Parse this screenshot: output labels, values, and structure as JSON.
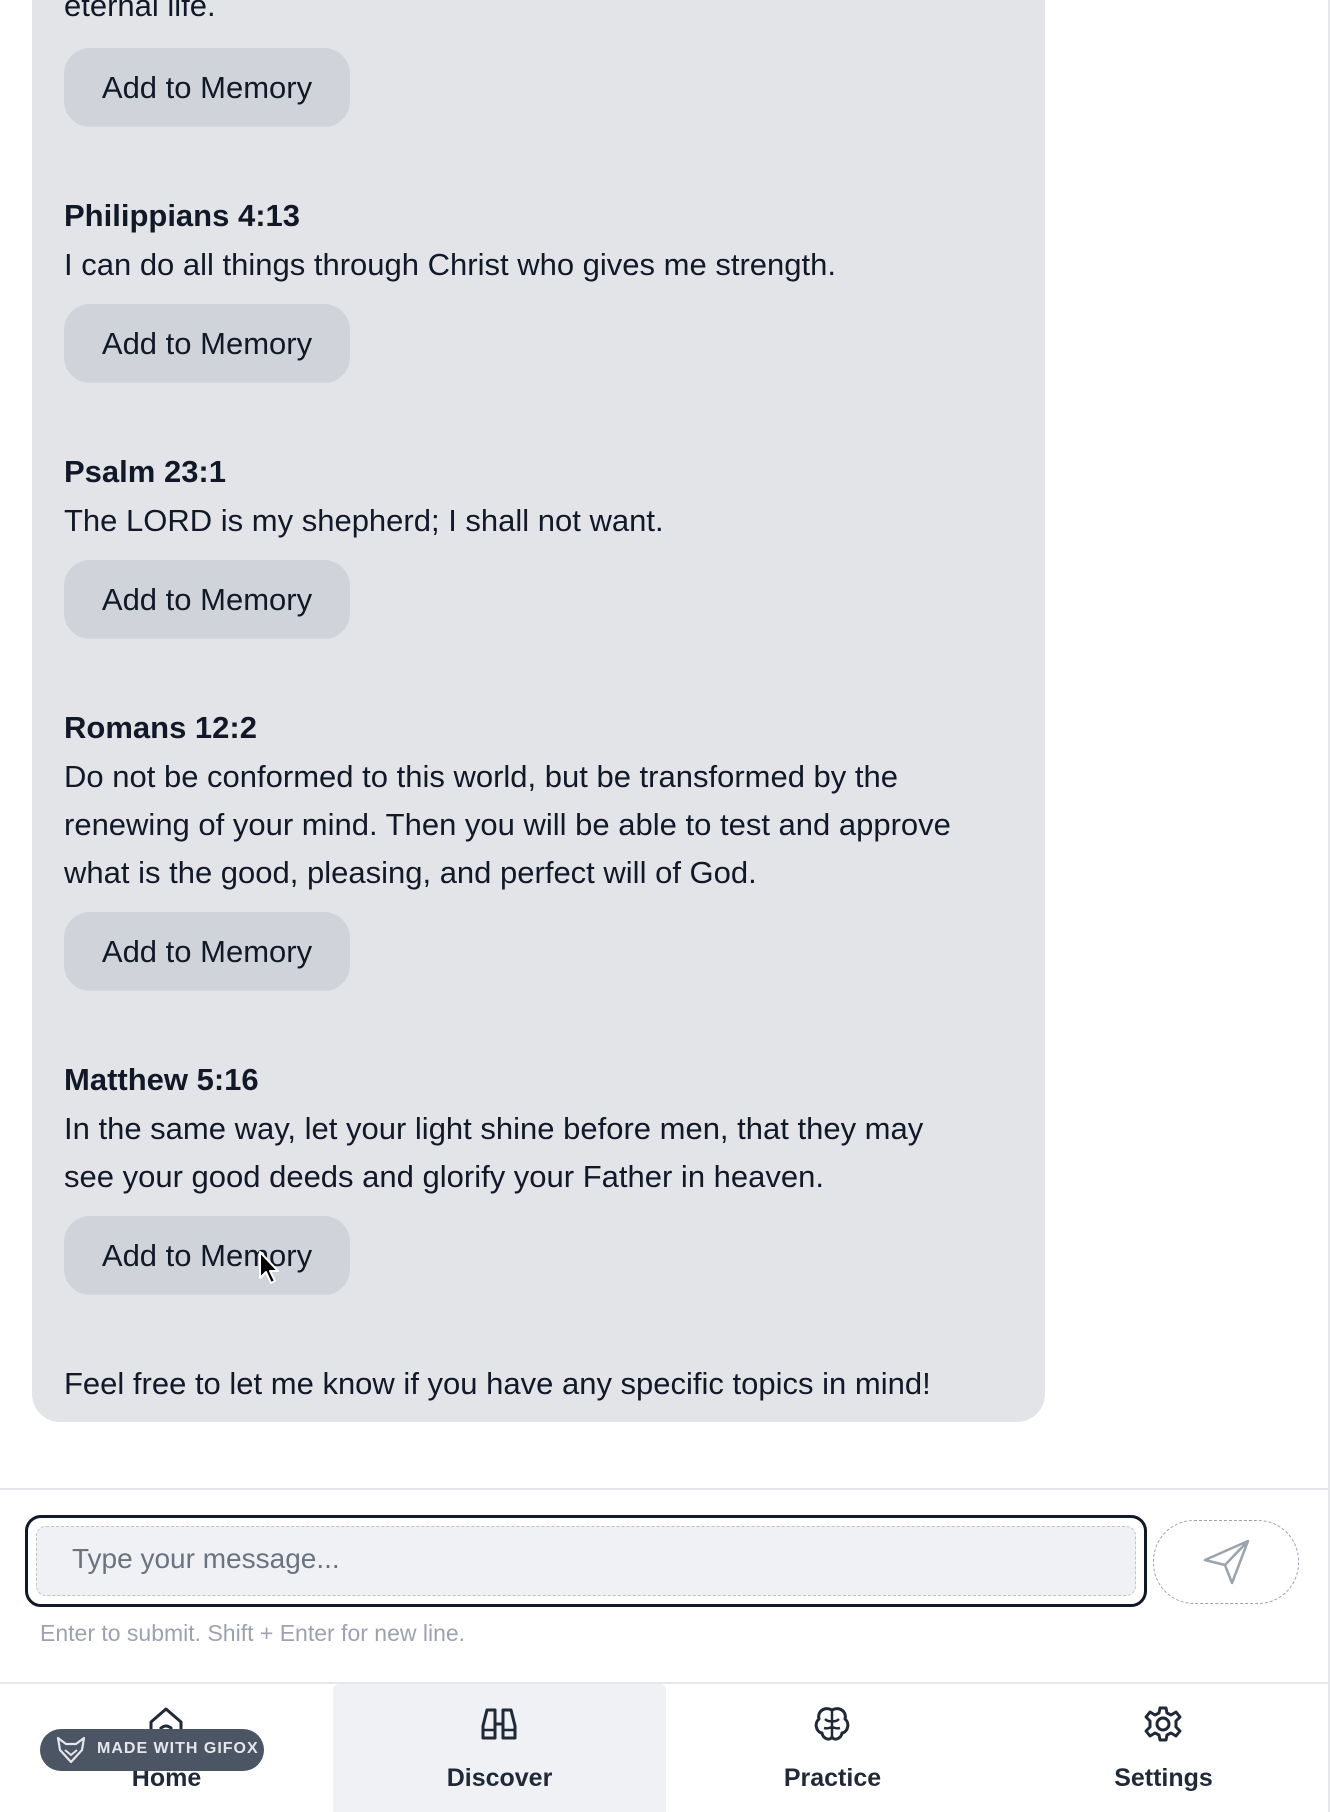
{
  "chat": {
    "trailing_text": "eternal life.",
    "add_label": "Add to Memory",
    "verses": [
      {
        "reference": "Philippians 4:13",
        "lines": [
          "I can do all things through Christ who gives me strength."
        ]
      },
      {
        "reference": "Psalm 23:1",
        "lines": [
          "The LORD is my shepherd; I shall not want."
        ]
      },
      {
        "reference": "Romans 12:2",
        "lines": [
          "Do not be conformed to this world, but be transformed by the",
          "renewing of your mind. Then you will be able to test and approve",
          "what is the good, pleasing, and perfect will of God."
        ]
      },
      {
        "reference": "Matthew 5:16",
        "lines": [
          "In the same way, let your light shine before men, that they may",
          "see your good deeds and glorify your Father in heaven."
        ]
      }
    ],
    "closing": "Feel free to let me know if you have any specific topics in mind!"
  },
  "composer": {
    "placeholder": "Type your message...",
    "hint": "Enter to submit. Shift + Enter for new line."
  },
  "nav": {
    "tabs": [
      {
        "label": "Home",
        "icon": "home-icon",
        "active": false
      },
      {
        "label": "Discover",
        "icon": "binoculars-icon",
        "active": true
      },
      {
        "label": "Practice",
        "icon": "brain-icon",
        "active": false
      },
      {
        "label": "Settings",
        "icon": "gear-icon",
        "active": false
      }
    ]
  },
  "watermark": {
    "text": "MADE WITH GIFOX"
  }
}
